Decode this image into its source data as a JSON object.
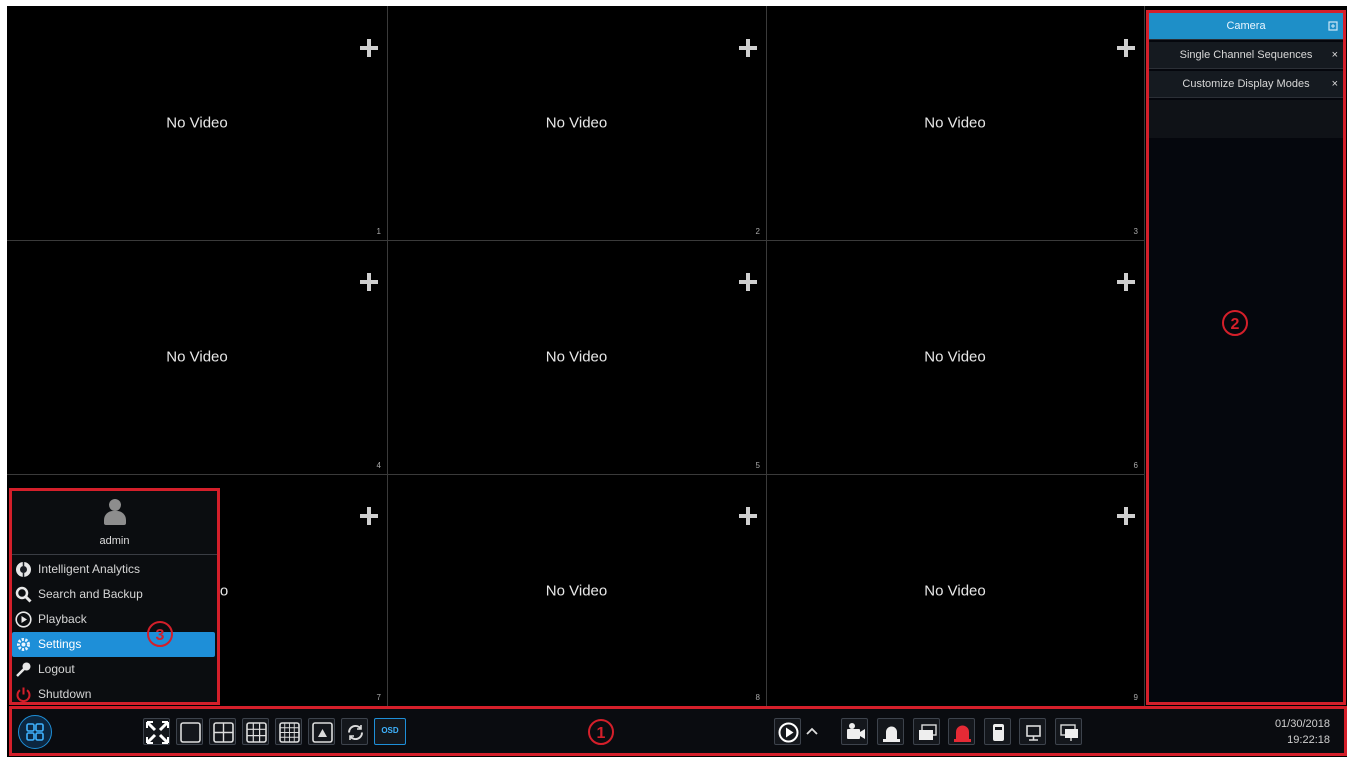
{
  "grid": {
    "cells": [
      {
        "label": "No Video",
        "number": "1"
      },
      {
        "label": "No Video",
        "number": "2"
      },
      {
        "label": "No Video",
        "number": "3"
      },
      {
        "label": "No Video",
        "number": "4"
      },
      {
        "label": "No Video",
        "number": "5"
      },
      {
        "label": "No Video",
        "number": "6"
      },
      {
        "label": "No Video",
        "number": "7"
      },
      {
        "label": "No Video",
        "number": "8"
      },
      {
        "label": "No Video",
        "number": "9"
      }
    ],
    "partial_label": "o"
  },
  "right_panel": {
    "items": [
      {
        "label": "Camera",
        "icon": "expand-icon",
        "active": true
      },
      {
        "label": "Single Channel Sequences",
        "icon": "close-icon"
      },
      {
        "label": "Customize Display Modes",
        "icon": "close-icon"
      }
    ],
    "close_glyph": "×",
    "annotation": "2"
  },
  "start_menu": {
    "user": "admin",
    "annotation": "3",
    "items": [
      {
        "label": "Intelligent Analytics",
        "icon": "analytics-icon"
      },
      {
        "label": "Search and Backup",
        "icon": "search-icon"
      },
      {
        "label": "Playback",
        "icon": "play-icon"
      },
      {
        "label": "Settings",
        "icon": "gear-icon",
        "selected": true
      },
      {
        "label": "Logout",
        "icon": "key-icon"
      },
      {
        "label": "Shutdown",
        "icon": "power-icon"
      }
    ]
  },
  "taskbar": {
    "annotation": "1",
    "osd_label": "OSD",
    "date": "01/30/2018",
    "time": "19:22:18"
  },
  "colors": {
    "annotation_red": "#d41f2a",
    "accent_blue": "#1e8fd8",
    "background": "#000000"
  }
}
